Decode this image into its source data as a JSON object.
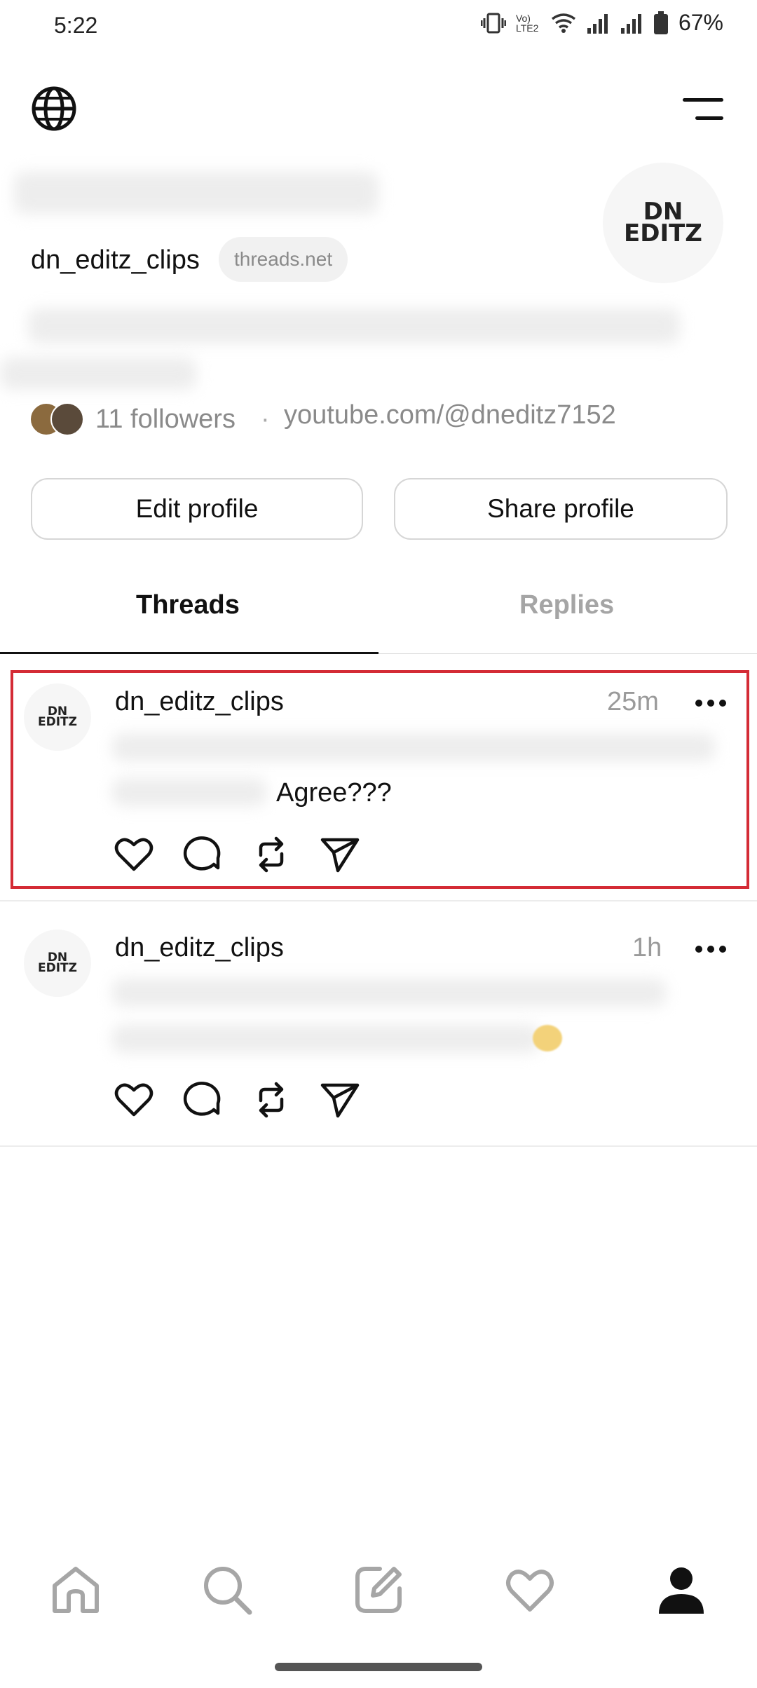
{
  "status_bar": {
    "time": "5:22",
    "network_label": "Vo) LTE2",
    "battery": "67%"
  },
  "profile": {
    "username": "dn_editz_clips",
    "domain_badge": "threads.net",
    "followers": "11 followers",
    "separator": "·",
    "link": "youtube.com/@dneditz7152",
    "avatar_logo": [
      "DN",
      "EDITZ"
    ]
  },
  "buttons": {
    "edit_profile": "Edit profile",
    "share_profile": "Share profile"
  },
  "tabs": [
    {
      "label": "Threads",
      "active": true
    },
    {
      "label": "Replies",
      "active": false
    }
  ],
  "posts": [
    {
      "username": "dn_editz_clips",
      "time": "25m",
      "visible_text": "Agree???",
      "logo": [
        "DN",
        "EDITZ"
      ]
    },
    {
      "username": "dn_editz_clips",
      "time": "1h",
      "visible_text": "",
      "logo": [
        "DN",
        "EDITZ"
      ]
    }
  ],
  "post_actions": [
    "heart-icon",
    "comment-icon",
    "repost-icon",
    "share-icon"
  ],
  "bottom_nav": [
    "home-icon",
    "search-icon",
    "compose-icon",
    "activity-icon",
    "profile-icon"
  ],
  "colors": {
    "highlight": "#d42b35",
    "muted": "#8a8a8a",
    "text": "#101010"
  }
}
